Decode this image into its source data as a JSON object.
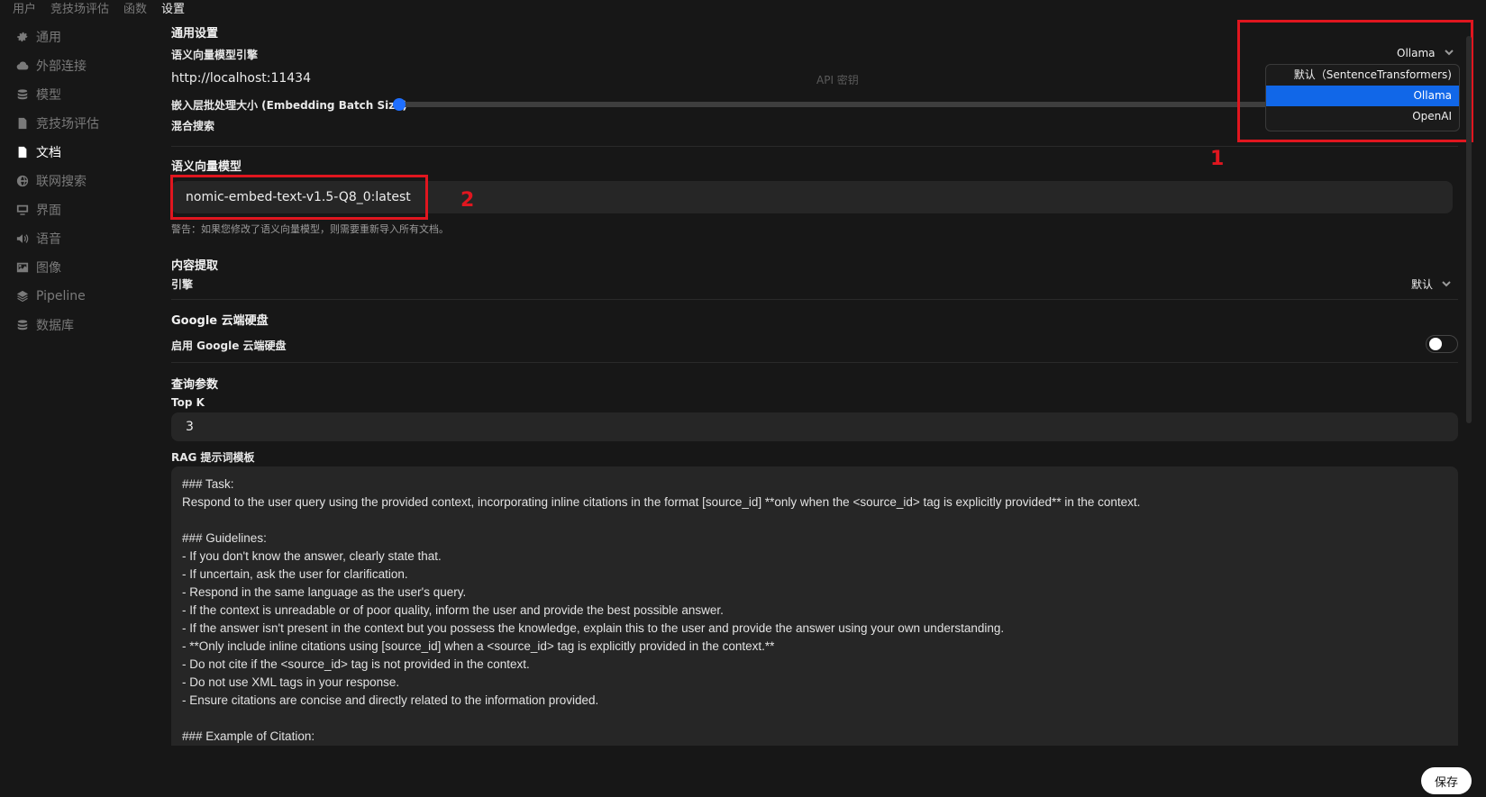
{
  "topnav": [
    "用户",
    "竞技场评估",
    "函数",
    "设置"
  ],
  "sidebar": {
    "items": [
      {
        "label": "通用",
        "icon": "gear-icon"
      },
      {
        "label": "外部连接",
        "icon": "cloud-icon"
      },
      {
        "label": "模型",
        "icon": "stack-icon"
      },
      {
        "label": "竞技场评估",
        "icon": "document-icon"
      },
      {
        "label": "文档",
        "icon": "document-filled-icon"
      },
      {
        "label": "联网搜索",
        "icon": "globe-icon"
      },
      {
        "label": "界面",
        "icon": "monitor-icon"
      },
      {
        "label": "语音",
        "icon": "speaker-icon"
      },
      {
        "label": "图像",
        "icon": "image-icon"
      },
      {
        "label": "Pipeline",
        "icon": "layers-icon"
      },
      {
        "label": "数据库",
        "icon": "database-icon"
      }
    ],
    "active_index": 4
  },
  "general": {
    "title": "通用设置",
    "engine_label": "语义向量模型引擎",
    "engine_value": "Ollama",
    "url": "http://localhost:11434",
    "api_key_placeholder": "API 密钥",
    "batch_label": "嵌入层批处理大小 (Embedding Batch Size)",
    "hybrid_label": "混合搜索"
  },
  "engine_dropdown": {
    "options": [
      "默认（SentenceTransformers)",
      "Ollama",
      "OpenAI"
    ],
    "selected_index": 1
  },
  "annotations": [
    "1",
    "2"
  ],
  "embedding": {
    "title": "语义向量模型",
    "model_value": "nomic-embed-text-v1.5-Q8_0:latest",
    "warning": "警告：如果您修改了语义向量模型，则需要重新导入所有文档。"
  },
  "content_extraction": {
    "title": "内容提取",
    "engine_label": "引擎",
    "engine_value": "默认"
  },
  "gdrive": {
    "title": "Google 云端硬盘",
    "enable_label": "启用 Google 云端硬盘",
    "enabled": false
  },
  "query": {
    "title": "查询参数",
    "topk_label": "Top K",
    "topk_value": "3",
    "rag_label": "RAG 提示词模板",
    "rag_template": "### Task:\nRespond to the user query using the provided context, incorporating inline citations in the format [source_id] **only when the <source_id> tag is explicitly provided** in the context.\n\n### Guidelines:\n- If you don't know the answer, clearly state that.\n- If uncertain, ask the user for clarification.\n- Respond in the same language as the user's query.\n- If the context is unreadable or of poor quality, inform the user and provide the best possible answer.\n- If the answer isn't present in the context but you possess the knowledge, explain this to the user and provide the answer using your own understanding.\n- **Only include inline citations using [source_id] when a <source_id> tag is explicitly provided in the context.**\n- Do not cite if the <source_id> tag is not provided in the context.\n- Do not use XML tags in your response.\n- Ensure citations are concise and directly related to the information provided.\n\n### Example of Citation:"
  },
  "save_label": "保存",
  "colors": {
    "background": "#171717",
    "accent": "#1167e8",
    "annotation": "#e0161f"
  }
}
